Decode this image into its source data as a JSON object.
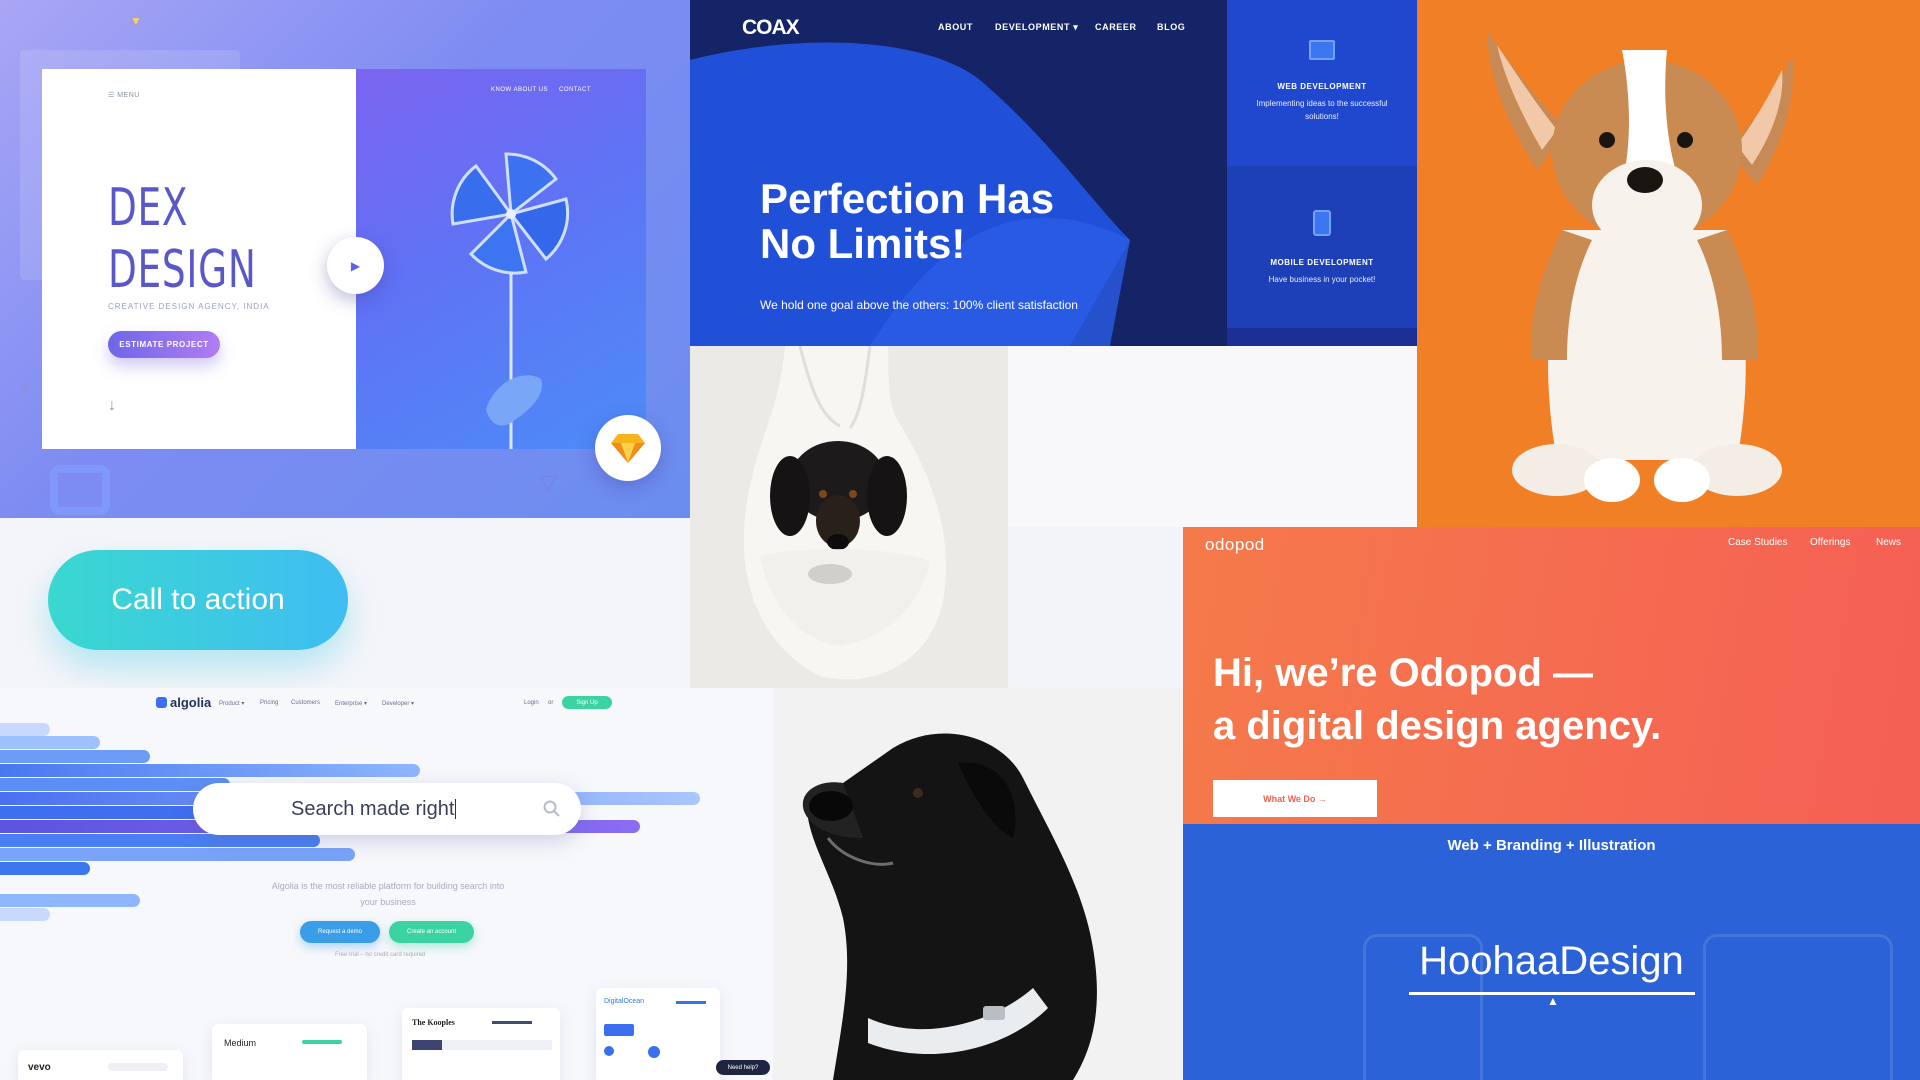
{
  "dex": {
    "menu": "☰  MENU",
    "title_line1": "DEX",
    "title_line2": "DESIGN",
    "subtitle": "CREATIVE DESIGN AGENCY, INDIA",
    "button": "ESTIMATE PROJECT",
    "nav": [
      "KNOW ABOUT US",
      "CONTACT"
    ],
    "arrow": "↓",
    "play": "▶"
  },
  "cta": {
    "label": "Call to action"
  },
  "coax": {
    "logo": "COAX",
    "nav": [
      "ABOUT",
      "DEVELOPMENT ▾",
      "CAREER",
      "BLOG"
    ],
    "title_line1": "Perfection Has",
    "title_line2": "No Limits!",
    "subtitle": "We hold one goal above the others: 100% client satisfaction",
    "cards": [
      {
        "title": "WEB DEVELOPMENT",
        "text": "Implementing ideas to the successful solutions!"
      },
      {
        "title": "MOBILE DEVELOPMENT",
        "text": "Have business in your pocket!"
      }
    ]
  },
  "algolia": {
    "logo": "algolia",
    "nav": [
      "Product ▾",
      "Pricing",
      "Customers",
      "Enterprise ▾",
      "Developer ▾"
    ],
    "login": "Login",
    "or": "or",
    "signup": "Sign Up",
    "search": "Search made right",
    "desc": "Algolia is the most reliable platform for building search into your business",
    "btn_demo": "Request a demo",
    "btn_account": "Create an account",
    "free": "Free trial – no credit card required",
    "brands": [
      "vevo",
      "Medium",
      "The Kooples",
      "DigitalOcean"
    ],
    "help": "Need help?"
  },
  "odopod": {
    "logo": "odopod",
    "nav": [
      "Case Studies",
      "Offerings",
      "News"
    ],
    "title_line1": "Hi, we’re Odopod —",
    "title_line2": "a digital design agency.",
    "button": "What We Do →"
  },
  "hoohaa": {
    "tagline": "Web + Branding + Illustration",
    "logo": "HoohaaDesign"
  }
}
